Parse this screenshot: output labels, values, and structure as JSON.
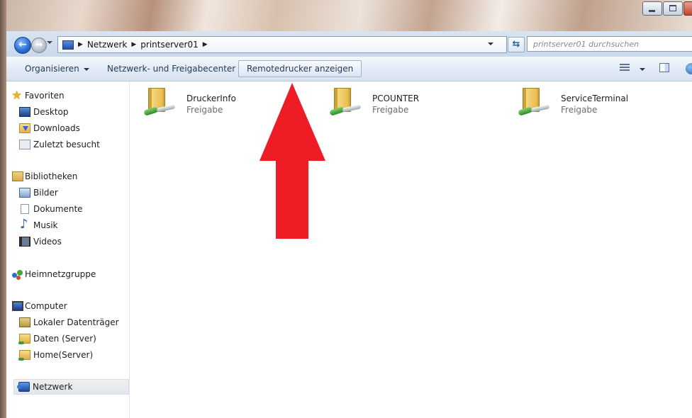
{
  "window": {
    "minimize_icon": "minimize-icon",
    "maximize_icon": "maximize-icon",
    "close_icon": "close-icon"
  },
  "address": {
    "path": [
      "Netzwerk",
      "printserver01"
    ],
    "search_placeholder": "printserver01 durchsuchen"
  },
  "toolbar": {
    "organize": "Organisieren",
    "network_center": "Netzwerk- und Freigabecenter",
    "remote_printers": "Remotedrucker anzeigen"
  },
  "nav": {
    "favorites": "Favoriten",
    "favorites_items": [
      "Desktop",
      "Downloads",
      "Zuletzt besucht"
    ],
    "libraries": "Bibliotheken",
    "libraries_items": [
      "Bilder",
      "Dokumente",
      "Musik",
      "Videos"
    ],
    "homegroup": "Heimnetzgruppe",
    "computer": "Computer",
    "computer_items": [
      "Lokaler Datenträger",
      "Daten (Server)",
      "Home(Server)"
    ],
    "network": "Netzwerk"
  },
  "shares": [
    {
      "name": "DruckerInfo",
      "type": "Freigabe"
    },
    {
      "name": "PCOUNTER",
      "type": "Freigabe"
    },
    {
      "name": "ServiceTerminal",
      "type": "Freigabe"
    }
  ],
  "colors": {
    "annotation_arrow": "#ee1c25"
  }
}
